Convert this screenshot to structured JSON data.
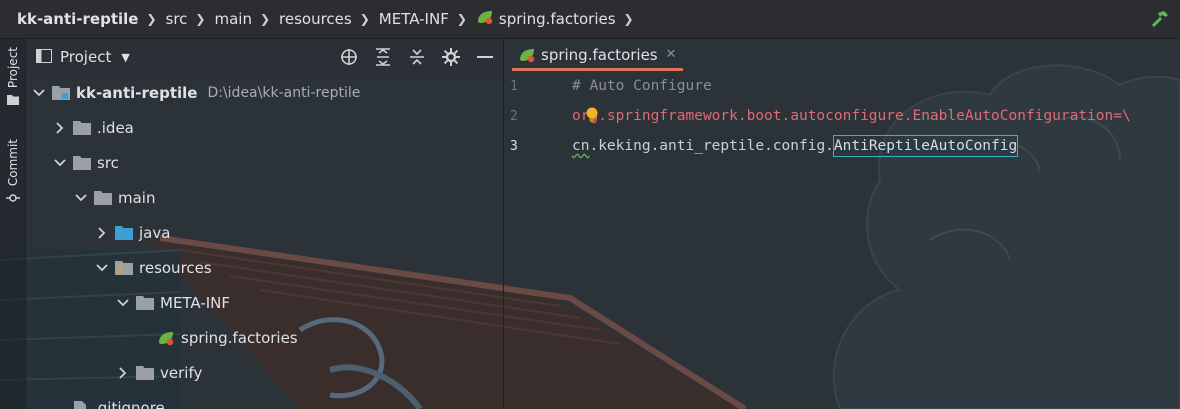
{
  "breadcrumb": {
    "items": [
      {
        "label": "kk-anti-reptile",
        "bold": true
      },
      {
        "label": "src"
      },
      {
        "label": "main"
      },
      {
        "label": "resources"
      },
      {
        "label": "META-INF"
      },
      {
        "label": "spring.factories",
        "icon": "spring-leaf-icon"
      }
    ]
  },
  "toolstrip": {
    "project_label": "Project",
    "commit_label": "Commit"
  },
  "project_panel": {
    "title": "Project",
    "tools": [
      "locate-icon",
      "expand-all-icon",
      "collapse-all-icon",
      "gear-icon",
      "hide-icon"
    ]
  },
  "tree": [
    {
      "label": "kk-anti-reptile",
      "path": "D:\\idea\\kk-anti-reptile",
      "expanded": true,
      "icon": "module-folder-icon"
    },
    {
      "label": ".idea",
      "expanded": false,
      "icon": "folder-icon"
    },
    {
      "label": "src",
      "expanded": true,
      "icon": "folder-icon"
    },
    {
      "label": "main",
      "expanded": true,
      "icon": "folder-icon"
    },
    {
      "label": "java",
      "expanded": false,
      "icon": "source-folder-icon"
    },
    {
      "label": "resources",
      "expanded": true,
      "icon": "resources-folder-icon"
    },
    {
      "label": "META-INF",
      "expanded": true,
      "icon": "folder-icon"
    },
    {
      "label": "spring.factories",
      "icon": "spring-leaf-icon"
    },
    {
      "label": "verify",
      "expanded": false,
      "icon": "folder-icon"
    },
    {
      "label": ".gitignore",
      "icon": "file-icon"
    }
  ],
  "editor": {
    "tab_label": "spring.factories",
    "lines": [
      {
        "num": "1",
        "text": "# Auto Configure"
      },
      {
        "num": "2",
        "text": "org.springframework.boot.autoconfigure.EnableAutoConfiguration=\\"
      },
      {
        "num": "3",
        "pkg_first": "cn",
        "pkg_rest": ".keking.anti_reptile.config.",
        "cls": "AntiReptileAutoConfig"
      }
    ]
  },
  "colors": {
    "accent_tab_underline": "#d9735b",
    "key_color": "#e46876",
    "selection_outline": "#2fb4c8",
    "folder": "#9aa0a6",
    "source_folder": "#3d9fd3",
    "spring": "#6db33f"
  }
}
